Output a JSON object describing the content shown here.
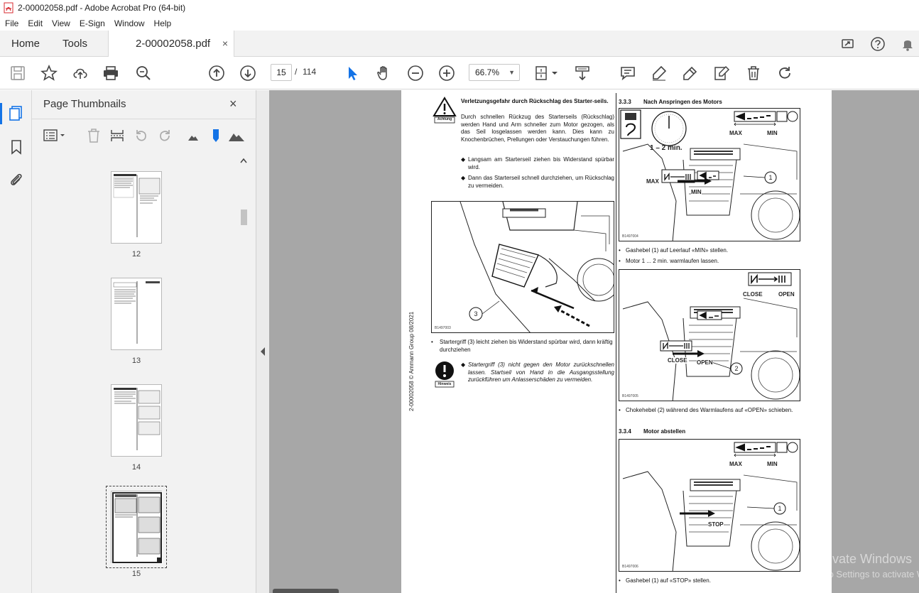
{
  "window": {
    "title": "2-00002058.pdf - Adobe Acrobat Pro (64-bit)"
  },
  "menu": [
    "File",
    "Edit",
    "View",
    "E-Sign",
    "Window",
    "Help"
  ],
  "tabs": {
    "home": "Home",
    "tools": "Tools",
    "document": "2-00002058.pdf",
    "close": "×"
  },
  "toolbar": {
    "current_page": "15",
    "page_separator": "/",
    "page_total": "114",
    "zoom": "66.7%"
  },
  "thumbnails": {
    "title": "Page Thumbnails",
    "close": "×",
    "pages": [
      {
        "label": "12"
      },
      {
        "label": "13"
      },
      {
        "label": "14"
      },
      {
        "label": "15"
      }
    ]
  },
  "document": {
    "side_text": "2-00002058 © Ammann Group 08/2021",
    "warning": {
      "icon_label": "Achtung",
      "title": "Verletzungsgefahr durch Rückschlag des Starter-seils.",
      "body": "Durch schnellen Rückzug des Starterseils (Rückschlag) werden Hand und Arm schneller zum Motor gezogen, als das Seil losgelassen werden kann. Dies kann zu Knochenbrüchen, Prellungen oder Verstauchungen führen.",
      "bullets": [
        "Langsam am Starterseil ziehen bis Widerstand spürbar wird.",
        "Dann das Starterseil schnell durchziehen, um Rückschlag zu vermeiden."
      ]
    },
    "figure_left": {
      "code": "B1497003",
      "callout": "3"
    },
    "left_bullet": "Startergriff (3) leicht ziehen bis Widerstand spürbar wird, dann kräftig durchziehen",
    "note": {
      "icon_label": "Hinweis",
      "body": "Startergriff (3) nicht gegen den Motor zurückschnellen lassen. Startseil von Hand in die Ausgangsstellung zurückführen um Anlasserschäden zu vermeiden."
    },
    "section_333": {
      "number": "3.3.3",
      "title": "Nach Anspringen des Motors",
      "figure1": {
        "code": "B1497004",
        "max": "MAX",
        "min": "MIN",
        "time": "1 – 2 min.",
        "max_inner": "MAX",
        "min_inner": "MIN",
        "callout": "1"
      },
      "bullets1": [
        "Gashebel (1) auf Leerlauf «MIN» stellen.",
        "Motor 1 ... 2 min. warmlaufen lassen."
      ],
      "figure2": {
        "code": "B1497005",
        "close": "CLOSE",
        "open": "OPEN",
        "close_inner": "CLOSE",
        "open_inner": "OPEN",
        "callout": "2"
      },
      "bullets2": [
        "Chokehebel (2) während des Warmlaufens auf «OPEN» schieben."
      ]
    },
    "section_334": {
      "number": "3.3.4",
      "title": "Motor abstellen",
      "figure": {
        "code": "B1497006",
        "max": "MAX",
        "min": "MIN",
        "stop": "STOP",
        "callout": "1"
      },
      "bullets": [
        "Gashebel (1) auf «STOP» stellen."
      ]
    }
  },
  "overlay": {
    "line1": "Activate Windows",
    "line2": "Go to Settings to activate Windows."
  },
  "colors": {
    "accent": "#1473e6",
    "acrobat_red": "#d7282f",
    "doc_bg": "#a7a7a7"
  }
}
